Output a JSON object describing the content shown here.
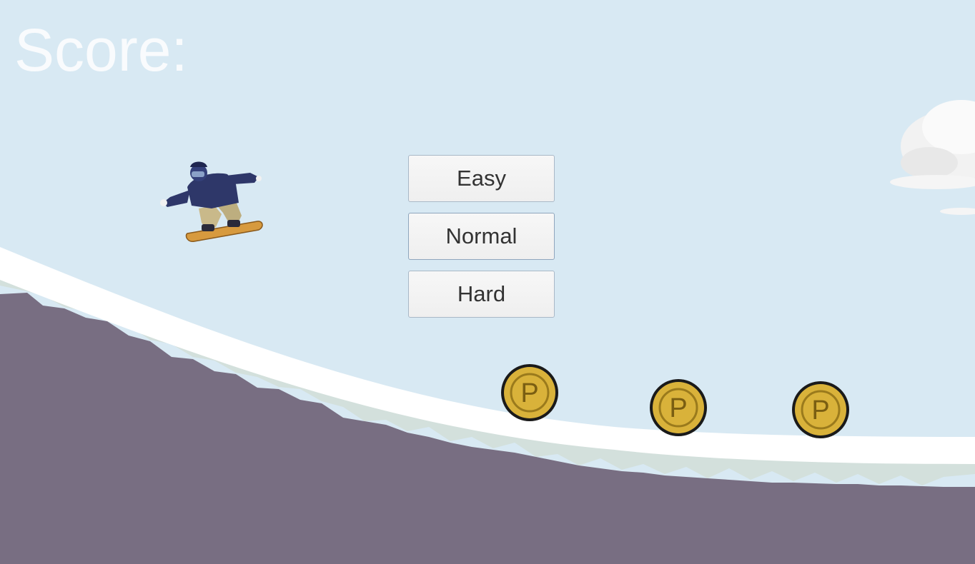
{
  "hud": {
    "score_label": "Score:"
  },
  "menu": {
    "buttons": [
      {
        "label": "Easy"
      },
      {
        "label": "Normal"
      },
      {
        "label": "Hard"
      }
    ]
  },
  "coins": {
    "symbol": "P",
    "count": 3
  },
  "colors": {
    "sky": "#d8e9f3",
    "snow": "#ffffff",
    "snow_shadow": "#d3e0dc",
    "rock": "#786e82",
    "coin_gold": "#d9b23a",
    "jacket": "#2e3769",
    "pants": "#c9b98a",
    "board": "#d79a3e"
  },
  "icons": [
    "snowboarder-player",
    "coin-icon",
    "cloud-icon"
  ]
}
